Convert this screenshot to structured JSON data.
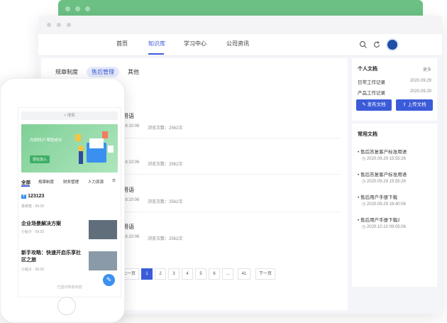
{
  "colors": {
    "accent": "#3b5bd9",
    "green_window": "#6cc084",
    "fab": "#3b8ff0"
  },
  "nav": {
    "items": [
      "首页",
      "知识库",
      "学习中心",
      "公司资讯"
    ],
    "active_index": 1,
    "icons": [
      "search-icon",
      "refresh-icon",
      "avatar"
    ]
  },
  "categories": {
    "items": [
      "规章制度",
      "售后管理",
      "其他"
    ],
    "active_index": 1
  },
  "list": {
    "rows": [
      {
        "title": "用语",
        "time": "18:10:06",
        "views": "浏览次数：2562次"
      },
      {
        "title": "",
        "time": "18:10:06",
        "views": "浏览次数：2562次"
      },
      {
        "title": "用语",
        "time": "18:10:06",
        "views": "浏览次数：2562次"
      },
      {
        "title": "用语",
        "time": "18:10:06",
        "views": "浏览次数：2562次"
      }
    ]
  },
  "pagination": {
    "prev": "上一页",
    "pages": [
      "1",
      "2",
      "3",
      "4",
      "5",
      "6",
      "...",
      "41"
    ],
    "next": "下一页",
    "active": "1"
  },
  "personal_docs": {
    "title": "个人文档",
    "more": "更多",
    "items": [
      {
        "name": "日常工作记录",
        "date": "2020.09.29"
      },
      {
        "name": "产品工作记录",
        "date": "2020.09.29"
      }
    ],
    "publish_btn": "发布文档",
    "upload_btn": "上传文档"
  },
  "common_docs": {
    "title": "常用文档",
    "items": [
      {
        "name": "售后答复客户标准用语",
        "time": "2020.09.29 15:55:26"
      },
      {
        "name": "售后答复客户标准用语",
        "time": "2020.09.29 15:55:26"
      },
      {
        "name": "售后用户手册下载",
        "time": "2020.09.29 16:40:06"
      },
      {
        "name": "售后用户手册下载2",
        "time": "2020.10.10 09:05:06"
      }
    ]
  },
  "phone": {
    "search_placeholder": "搜索",
    "banner_text": "内部知识 帮助成长",
    "banner_btn": "现在加入",
    "tabs": [
      "全部",
      "规章制度",
      "财务管理",
      "人力资源"
    ],
    "items": [
      {
        "title": "123123",
        "meta": "系统管 · 09.29",
        "badge": "T"
      },
      {
        "title": "企业场景解决方案",
        "meta": "小帖子 · 09.23"
      },
      {
        "title": "新手攻略：快速开启乐享社区之旅",
        "meta": "小帖子 · 09.23"
      }
    ],
    "footer": "已显示所有内容"
  }
}
